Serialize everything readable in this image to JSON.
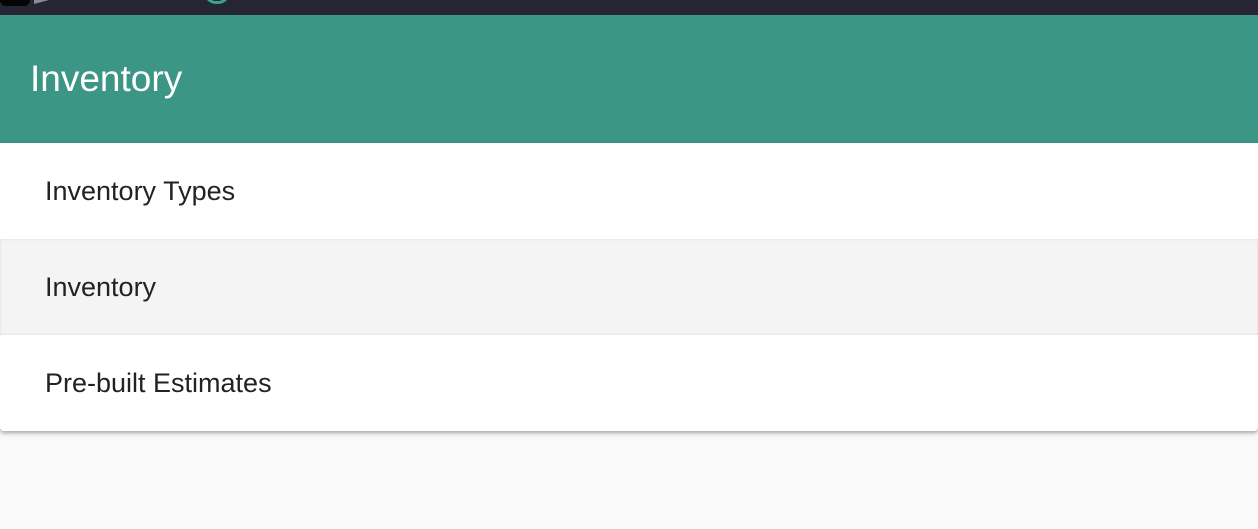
{
  "colors": {
    "topbar": "#252533",
    "header": "#3b9686",
    "header_text": "#ffffff",
    "item_text": "#222222",
    "item_alt_bg": "#f4f4f4",
    "page_bg": "#f9f9f9"
  },
  "header": {
    "title": "Inventory"
  },
  "menu": {
    "items": [
      {
        "label": "Inventory Types"
      },
      {
        "label": "Inventory"
      },
      {
        "label": "Pre-built Estimates"
      }
    ]
  }
}
